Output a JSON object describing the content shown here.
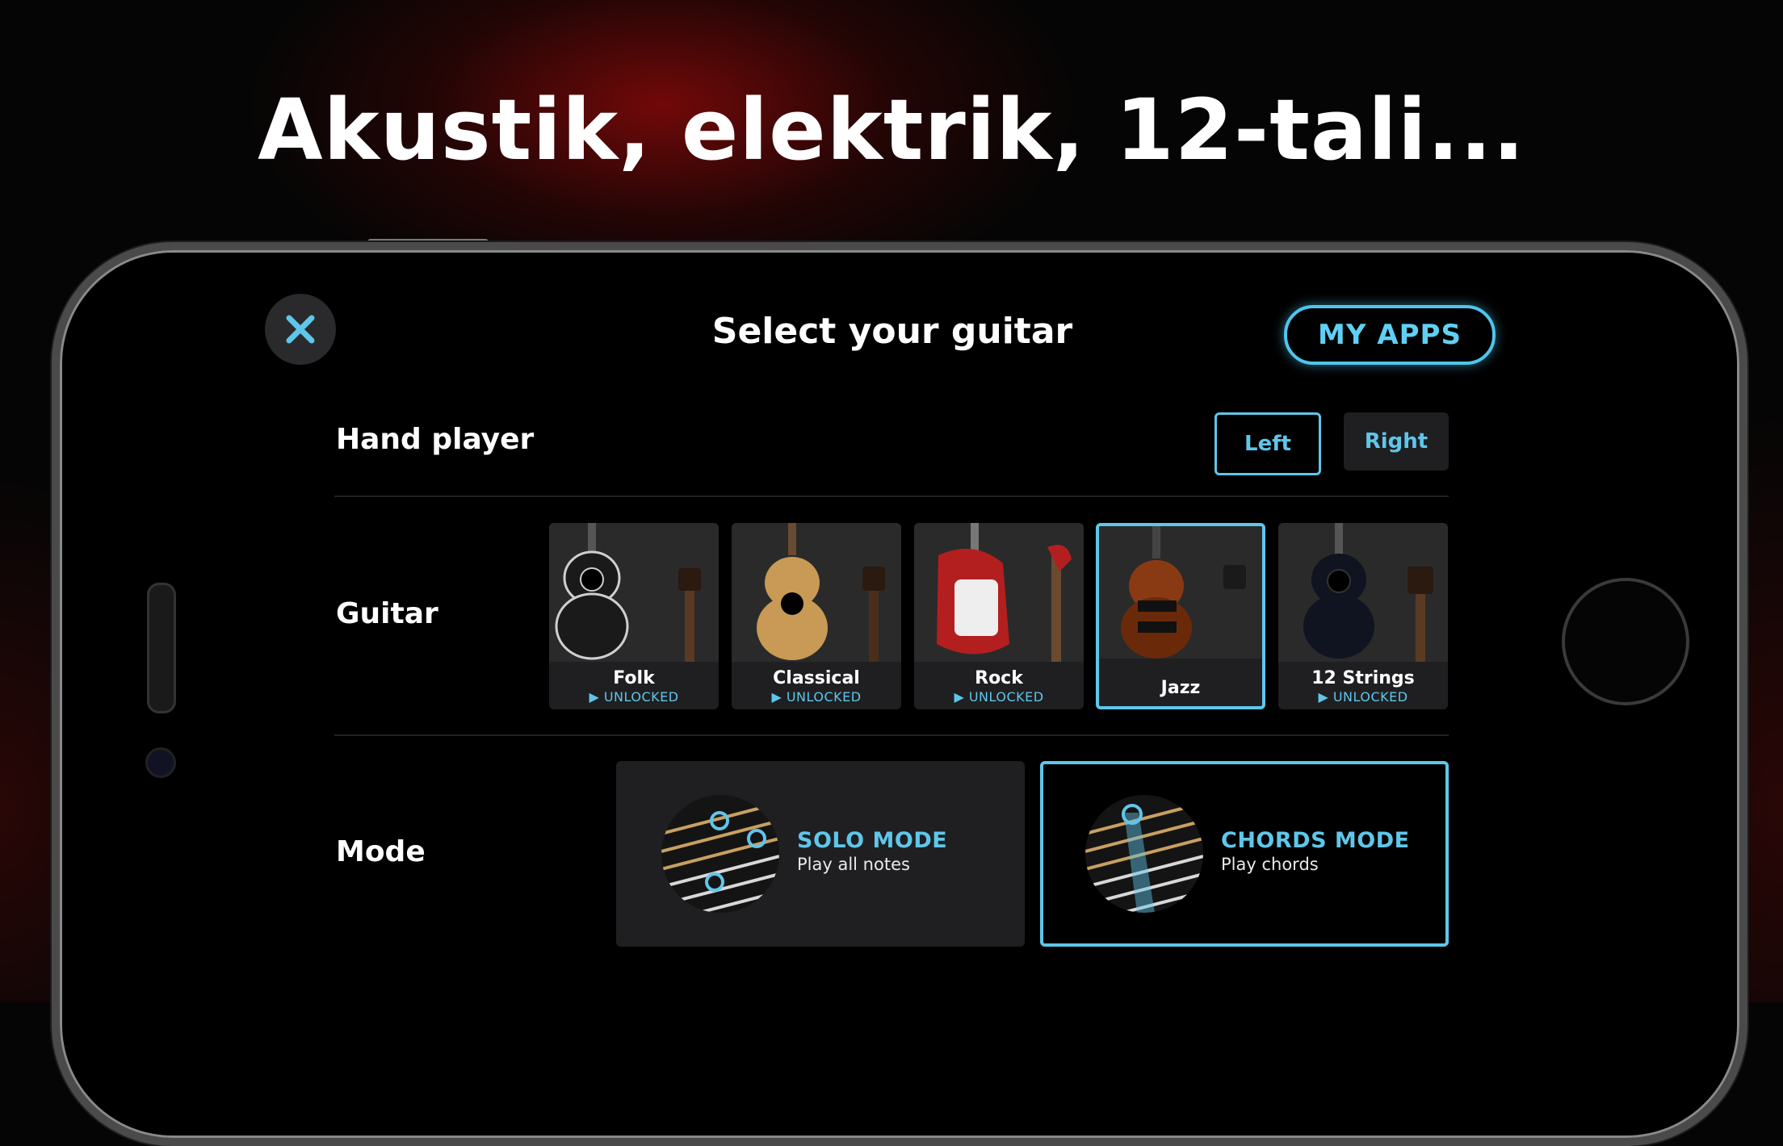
{
  "headline": "Akustik, elektrik, 12-tali...",
  "screen": {
    "title": "Select your guitar",
    "my_apps_label": "MY APPS"
  },
  "hand_player": {
    "label": "Hand player",
    "options": [
      "Left",
      "Right"
    ],
    "selected": "Left"
  },
  "guitar": {
    "label": "Guitar",
    "items": [
      {
        "name": "Folk",
        "status": "▶ UNLOCKED",
        "color": "#1a1a1a"
      },
      {
        "name": "Classical",
        "status": "▶ UNLOCKED",
        "color": "#c89a55"
      },
      {
        "name": "Rock",
        "status": "▶ UNLOCKED",
        "color": "#b31f1f"
      },
      {
        "name": "Jazz",
        "status": "",
        "color": "#8a3a12"
      },
      {
        "name": "12 Strings",
        "status": "▶ UNLOCKED",
        "color": "#0f1420"
      }
    ],
    "selected": "Jazz"
  },
  "mode": {
    "label": "Mode",
    "items": [
      {
        "title": "SOLO MODE",
        "subtitle": "Play all notes"
      },
      {
        "title": "CHORDS MODE",
        "subtitle": "Play chords"
      }
    ],
    "selected": "CHORDS MODE"
  },
  "colors": {
    "accent": "#5fc6ea",
    "card_bg": "#1f1f21",
    "background": "#000000"
  }
}
